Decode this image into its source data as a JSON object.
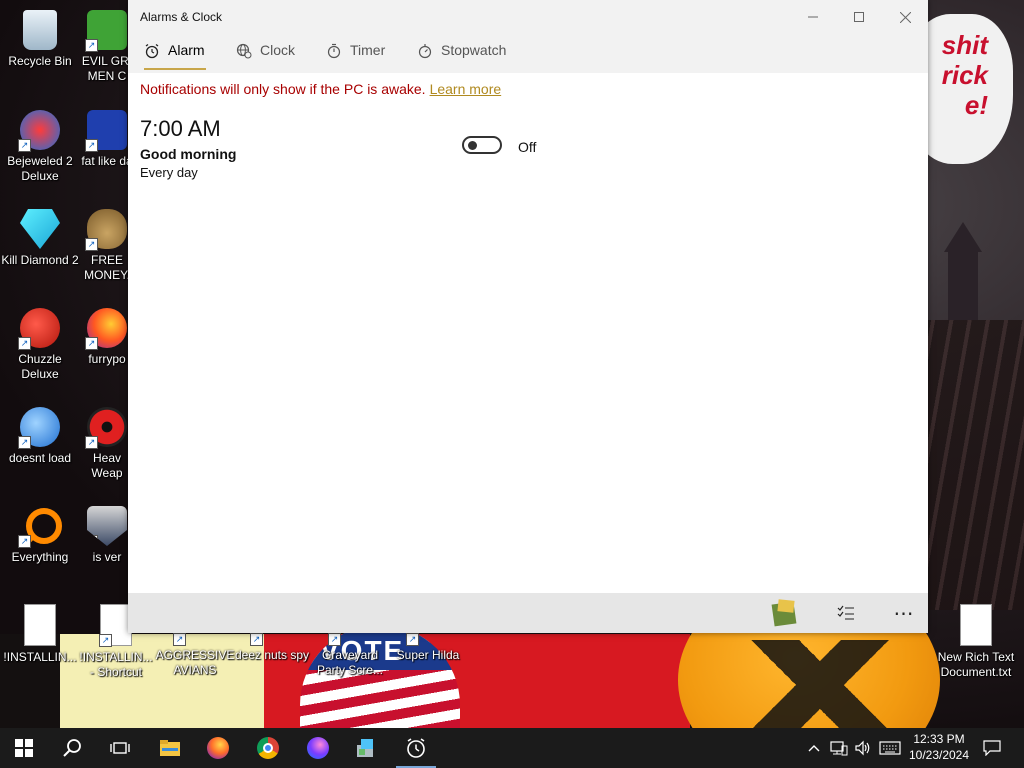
{
  "window": {
    "title": "Alarms & Clock",
    "minimize_icon": "minimize-icon",
    "maximize_icon": "maximize-icon",
    "close_icon": "close-icon"
  },
  "tabs": [
    {
      "label": "Alarm",
      "icon": "alarm-icon",
      "active": true
    },
    {
      "label": "Clock",
      "icon": "world-clock-icon",
      "active": false
    },
    {
      "label": "Timer",
      "icon": "timer-icon",
      "active": false
    },
    {
      "label": "Stopwatch",
      "icon": "stopwatch-icon",
      "active": false
    }
  ],
  "notice": {
    "text": "Notifications will only show if the PC is awake.",
    "link": "Learn more"
  },
  "alarms": [
    {
      "time": "7:00 AM",
      "name": "Good morning",
      "repeat": "Every day",
      "toggle_state": "Off",
      "enabled": false
    }
  ],
  "commandbar": {
    "items": [
      "bonus-pack-icon",
      "select-alarms-icon",
      "more-icon"
    ],
    "more_label": "⋯"
  },
  "desktop_icons": [
    {
      "label": "Recycle Bin",
      "icon": "recycle-bin-icon"
    },
    {
      "label": "EVIL GRI MEN C",
      "icon": "evil-grimen-icon"
    },
    {
      "label": "Bejeweled 2 Deluxe",
      "icon": "bejeweled-icon"
    },
    {
      "label": "fat like da",
      "icon": "game-icon"
    },
    {
      "label": "Kill Diamond 2",
      "icon": "diamond-icon"
    },
    {
      "label": "FREE MONEY.",
      "icon": "money-bag-icon"
    },
    {
      "label": "Chuzzle Deluxe",
      "icon": "chuzzle-icon"
    },
    {
      "label": "furrypo",
      "icon": "firefox-icon"
    },
    {
      "label": "doesnt load",
      "icon": "thunderbird-icon"
    },
    {
      "label": "Heav Weap",
      "icon": "radiation-icon"
    },
    {
      "label": "Everything",
      "icon": "search-icon"
    },
    {
      "label": "is ver",
      "icon": "shield-icon"
    },
    {
      "label": "!INSTALLIN...",
      "icon": "text-file-icon"
    },
    {
      "label": "!INSTALLIN... - Shortcut",
      "icon": "text-file-icon"
    },
    {
      "label": "AGGRESSIVE AVIANS",
      "icon": "game-icon"
    },
    {
      "label": "deez nuts spy",
      "icon": "game-icon"
    },
    {
      "label": "Graveyard Party Scre...",
      "icon": "game-icon"
    },
    {
      "label": "Super Hilda",
      "icon": "game-icon"
    },
    {
      "label": "New Rich Text Document.txt",
      "icon": "text-file-icon"
    }
  ],
  "wallpaper": {
    "cloud_text": "shit rick e!",
    "vote_text": "VOTE"
  },
  "taskbar": {
    "items": [
      "start-icon",
      "search-icon",
      "task-view-icon",
      "file-explorer-icon",
      "firefox-icon",
      "chrome-icon",
      "firefox-nightly-icon",
      "app-installer-icon",
      "alarms-clock-icon"
    ],
    "time": "12:33 PM",
    "date": "10/23/2024"
  },
  "colors": {
    "accent": "#c8a64a",
    "notice_red": "#a80000",
    "link_gold": "#b08a20",
    "taskbar": "#1b1b1b",
    "window_chrome": "#f2f2f2"
  }
}
